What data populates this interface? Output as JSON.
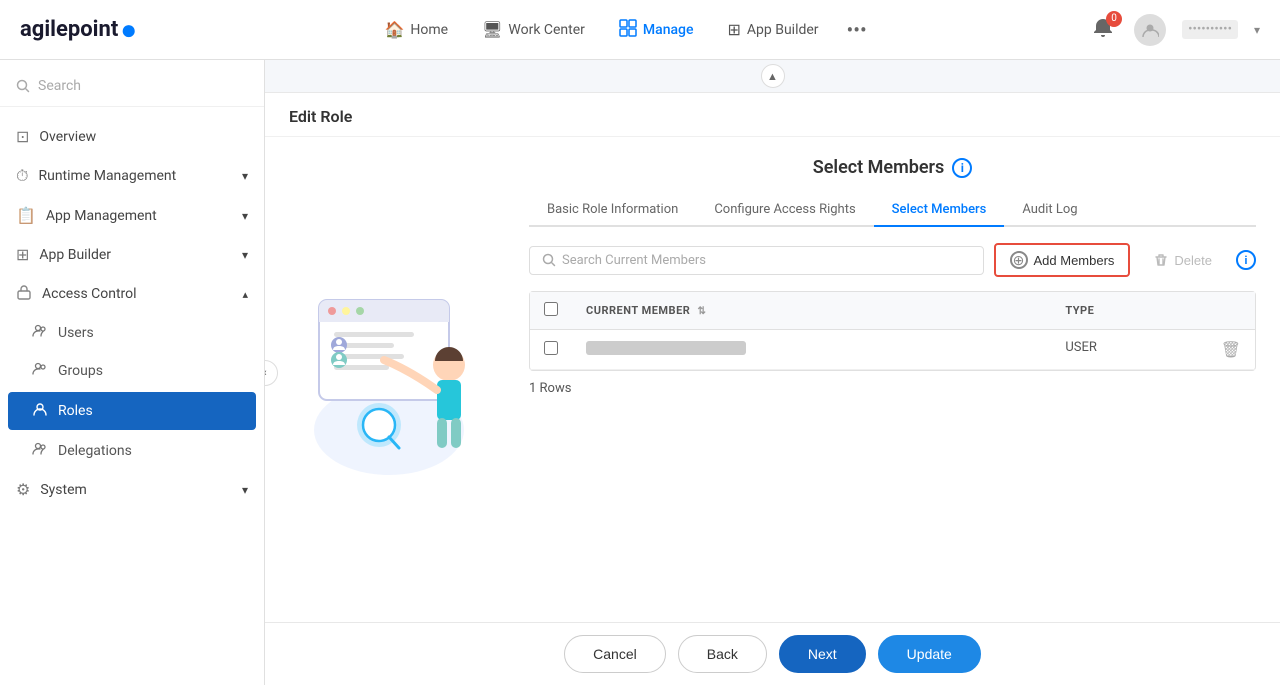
{
  "app": {
    "logo": "agilepoint",
    "logo_dot": "●"
  },
  "nav": {
    "items": [
      {
        "id": "home",
        "label": "Home",
        "icon": "🏠"
      },
      {
        "id": "work-center",
        "label": "Work Center",
        "icon": "🖥"
      },
      {
        "id": "manage",
        "label": "Manage",
        "icon": "💼",
        "active": true
      },
      {
        "id": "app-builder",
        "label": "App Builder",
        "icon": "⊞"
      }
    ],
    "more_icon": "•••",
    "notification_count": "0",
    "user_name_placeholder": "••••••••••"
  },
  "sidebar": {
    "search_placeholder": "Search",
    "items": [
      {
        "id": "overview",
        "label": "Overview",
        "icon": "⊡"
      },
      {
        "id": "runtime-management",
        "label": "Runtime Management",
        "icon": "⏱",
        "has_arrow": true
      },
      {
        "id": "app-management",
        "label": "App Management",
        "icon": "📋",
        "has_arrow": true
      },
      {
        "id": "app-builder",
        "label": "App Builder",
        "icon": "⊞",
        "has_arrow": true
      },
      {
        "id": "access-control",
        "label": "Access Control",
        "icon": "🔒",
        "expanded": true
      },
      {
        "id": "users",
        "label": "Users",
        "icon": "👥"
      },
      {
        "id": "groups",
        "label": "Groups",
        "icon": "👥"
      },
      {
        "id": "roles",
        "label": "Roles",
        "icon": "👤",
        "active": true
      },
      {
        "id": "delegations",
        "label": "Delegations",
        "icon": "👥"
      },
      {
        "id": "system",
        "label": "System",
        "icon": "⚙",
        "has_arrow": true
      }
    ]
  },
  "page": {
    "title": "Edit Role",
    "panel_title": "Select Members",
    "tabs": [
      {
        "id": "basic-role-info",
        "label": "Basic Role Information"
      },
      {
        "id": "configure-access",
        "label": "Configure Access Rights"
      },
      {
        "id": "select-members",
        "label": "Select Members",
        "active": true
      },
      {
        "id": "audit-log",
        "label": "Audit Log"
      }
    ],
    "toolbar": {
      "search_placeholder": "Search Current Members",
      "add_members_label": "Add Members",
      "delete_label": "Delete"
    },
    "table": {
      "headers": [
        {
          "id": "current-member",
          "label": "CURRENT MEMBER",
          "sortable": true
        },
        {
          "id": "type",
          "label": "TYPE",
          "sortable": false
        }
      ],
      "rows": [
        {
          "name_blur": true,
          "type": "USER"
        }
      ],
      "rows_count": "1 Rows"
    },
    "footer": {
      "cancel_label": "Cancel",
      "back_label": "Back",
      "next_label": "Next",
      "update_label": "Update"
    }
  }
}
